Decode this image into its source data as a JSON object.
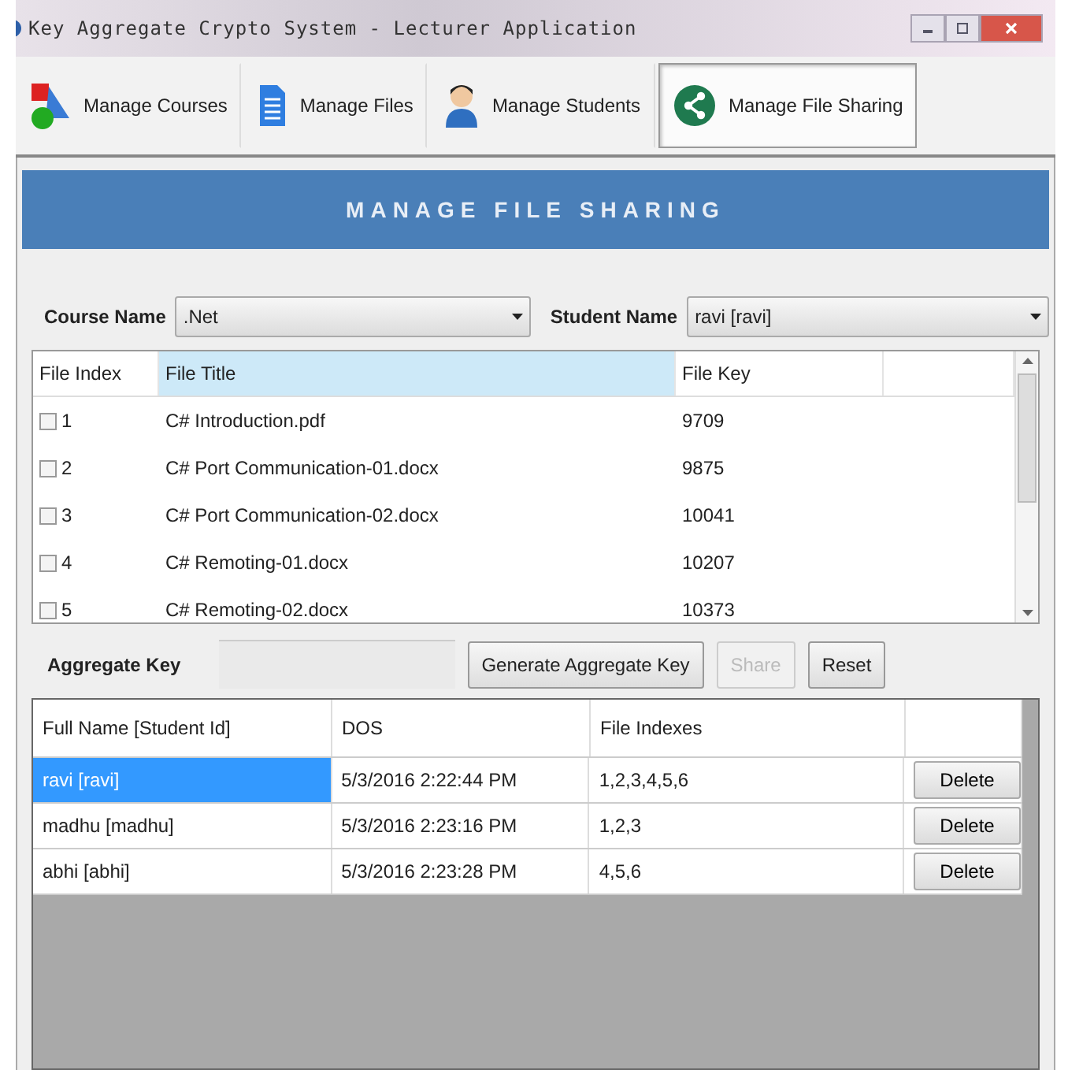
{
  "window": {
    "title": "Key Aggregate Crypto System - Lecturer Application"
  },
  "tabs": [
    {
      "label": "Manage Courses",
      "selected": false
    },
    {
      "label": "Manage Files",
      "selected": false
    },
    {
      "label": "Manage Students",
      "selected": false
    },
    {
      "label": "Manage File Sharing",
      "selected": true
    }
  ],
  "header": "MANAGE FILE SHARING",
  "course": {
    "label": "Course Name",
    "value": ".Net"
  },
  "student": {
    "label": "Student Name",
    "value": "ravi [ravi]"
  },
  "files_table": {
    "columns": [
      "File Index",
      "File Title",
      "File Key"
    ],
    "rows": [
      {
        "index": "1",
        "title": "C# Introduction.pdf",
        "key": "9709",
        "checked": false
      },
      {
        "index": "2",
        "title": "C# Port Communication-01.docx",
        "key": "9875",
        "checked": false
      },
      {
        "index": "3",
        "title": "C# Port Communication-02.docx",
        "key": "10041",
        "checked": false
      },
      {
        "index": "4",
        "title": "C# Remoting-01.docx",
        "key": "10207",
        "checked": false
      },
      {
        "index": "5",
        "title": "C# Remoting-02.docx",
        "key": "10373",
        "checked": false
      }
    ]
  },
  "aggregate_key": {
    "label": "Aggregate Key"
  },
  "buttons": [
    {
      "label": "Generate Aggregate Key",
      "disabled": false
    },
    {
      "label": "Share",
      "disabled": true
    },
    {
      "label": "Reset",
      "disabled": false
    }
  ],
  "shares_table": {
    "columns": [
      "Full Name [Student Id]",
      "DOS",
      "File Indexes"
    ],
    "rows": [
      {
        "name": "ravi [ravi]",
        "dos": "5/3/2016 2:22:44 PM",
        "indexes": "1,2,3,4,5,6",
        "action": "Delete",
        "selected": true
      },
      {
        "name": "madhu [madhu]",
        "dos": "5/3/2016 2:23:16 PM",
        "indexes": "1,2,3",
        "action": "Delete",
        "selected": false
      },
      {
        "name": "abhi [abhi]",
        "dos": "5/3/2016 2:23:28 PM",
        "indexes": "4,5,6",
        "action": "Delete",
        "selected": false
      }
    ]
  }
}
